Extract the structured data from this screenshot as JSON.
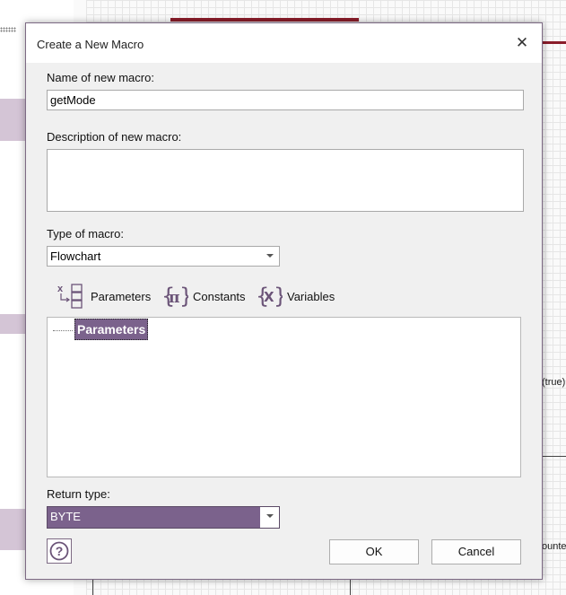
{
  "background": {
    "right_labels": [
      "(true)",
      "ounte"
    ]
  },
  "dialog": {
    "title": "Create a New Macro",
    "close_glyph": "✕",
    "name_label": "Name of new macro:",
    "name_value": "getMode",
    "description_label": "Description of new macro:",
    "description_value": "",
    "type_label": "Type of macro:",
    "type_value": "Flowchart",
    "tabs": [
      {
        "label": "Parameters",
        "icon": "parameters-icon"
      },
      {
        "label": "Constants",
        "icon": "constants-icon"
      },
      {
        "label": "Variables",
        "icon": "variables-icon"
      }
    ],
    "tree_root": "Parameters",
    "return_label": "Return type:",
    "return_value": "BYTE",
    "ok_label": "OK",
    "cancel_label": "Cancel"
  },
  "colors": {
    "accent": "#7b628c",
    "icon_purple": "#6b5478",
    "dark_red": "#8a1d2a"
  }
}
